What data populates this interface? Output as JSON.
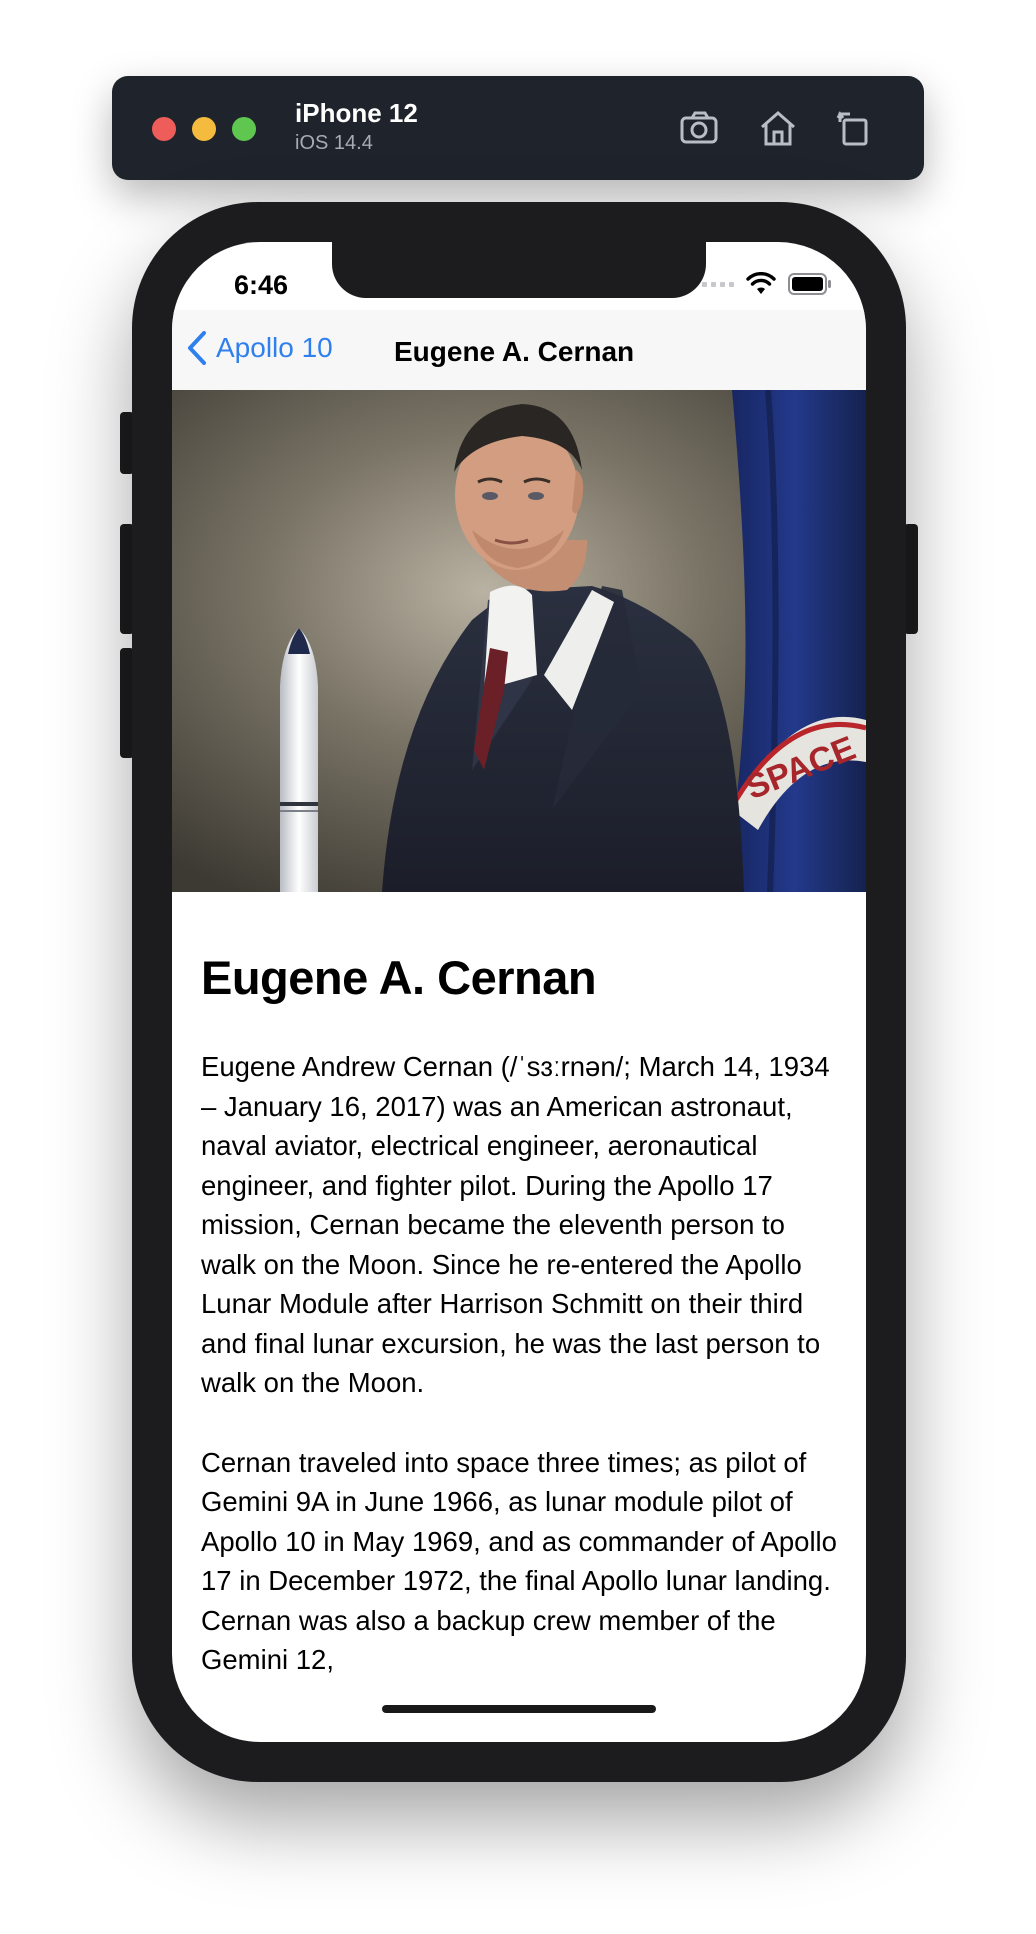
{
  "simulator": {
    "device": "iPhone 12",
    "os": "iOS 14.4"
  },
  "status_bar": {
    "time": "6:46"
  },
  "nav": {
    "back_label": "Apollo 10",
    "title": "Eugene A. Cernan"
  },
  "hero": {
    "flag_text": "SPACE"
  },
  "article": {
    "heading": "Eugene A. Cernan",
    "paragraphs": [
      "Eugene Andrew Cernan (/ˈsɜːrnən/; March 14, 1934 – January 16, 2017) was an American astronaut, naval aviator, electrical engineer, aeronautical engineer, and fighter pilot. During the Apollo 17 mission, Cernan became the eleventh person to walk on the Moon. Since he re-entered the Apollo Lunar Module after Harrison Schmitt on their third and final lunar excursion, he was the last person to walk on the Moon.",
      "Cernan traveled into space three times; as pilot of Gemini 9A in June 1966, as lunar module pilot of Apollo 10 in May 1969, and as commander of Apollo 17 in December 1972, the final Apollo lunar landing. Cernan was also a backup crew member of the Gemini 12,"
    ]
  },
  "colors": {
    "accent": "#2f80ed",
    "sim_bar": "#1f232b",
    "phone_frame": "#1c1c1e"
  }
}
